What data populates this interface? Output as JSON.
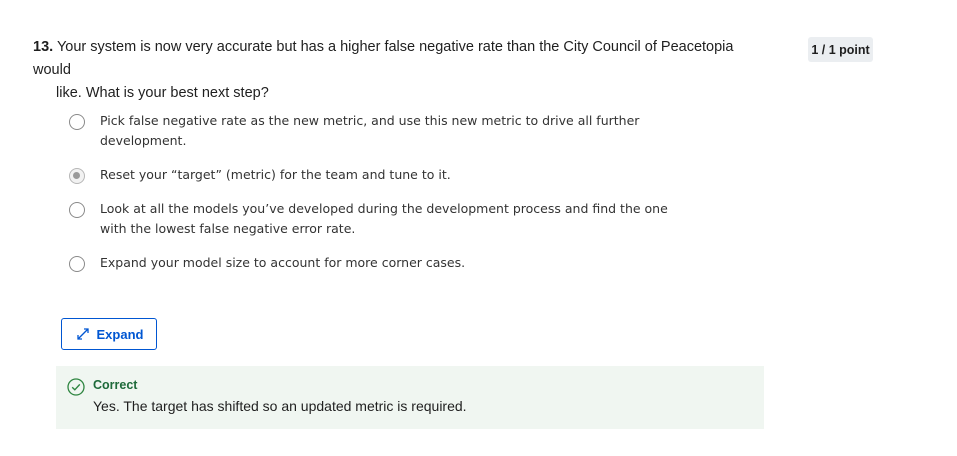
{
  "question": {
    "number": "13.",
    "text_line1": "Your system is now very accurate but has a higher false negative rate than the City Council of Peacetopia would",
    "text_line2": "like. What is your best next step?"
  },
  "score": {
    "label": "1 / 1 point"
  },
  "options": [
    {
      "line1": "Pick false negative rate as the new metric, and use this new metric to drive all further",
      "line2": "development.",
      "selected": false
    },
    {
      "line1": "Reset your “target” (metric) for the team and tune to it.",
      "line2": "",
      "selected": true
    },
    {
      "line1": "Look at all the models you’ve developed during the development process and find the one",
      "line2": "with the lowest false negative error rate.",
      "selected": false
    },
    {
      "line1": "Expand your model size to account for more corner cases.",
      "line2": "",
      "selected": false
    }
  ],
  "expand": {
    "label": "Expand",
    "icon": "expand-arrows-icon"
  },
  "feedback": {
    "status": "Correct",
    "explanation": "Yes. The target has shifted so an updated metric is required.",
    "icon": "check-circle-icon"
  },
  "colors": {
    "accent": "#0056d2",
    "correct_text": "#1e6a3a",
    "correct_icon": "#2e8540",
    "feedback_bg": "#f0f6f1",
    "badge_bg": "#ebeef1"
  }
}
